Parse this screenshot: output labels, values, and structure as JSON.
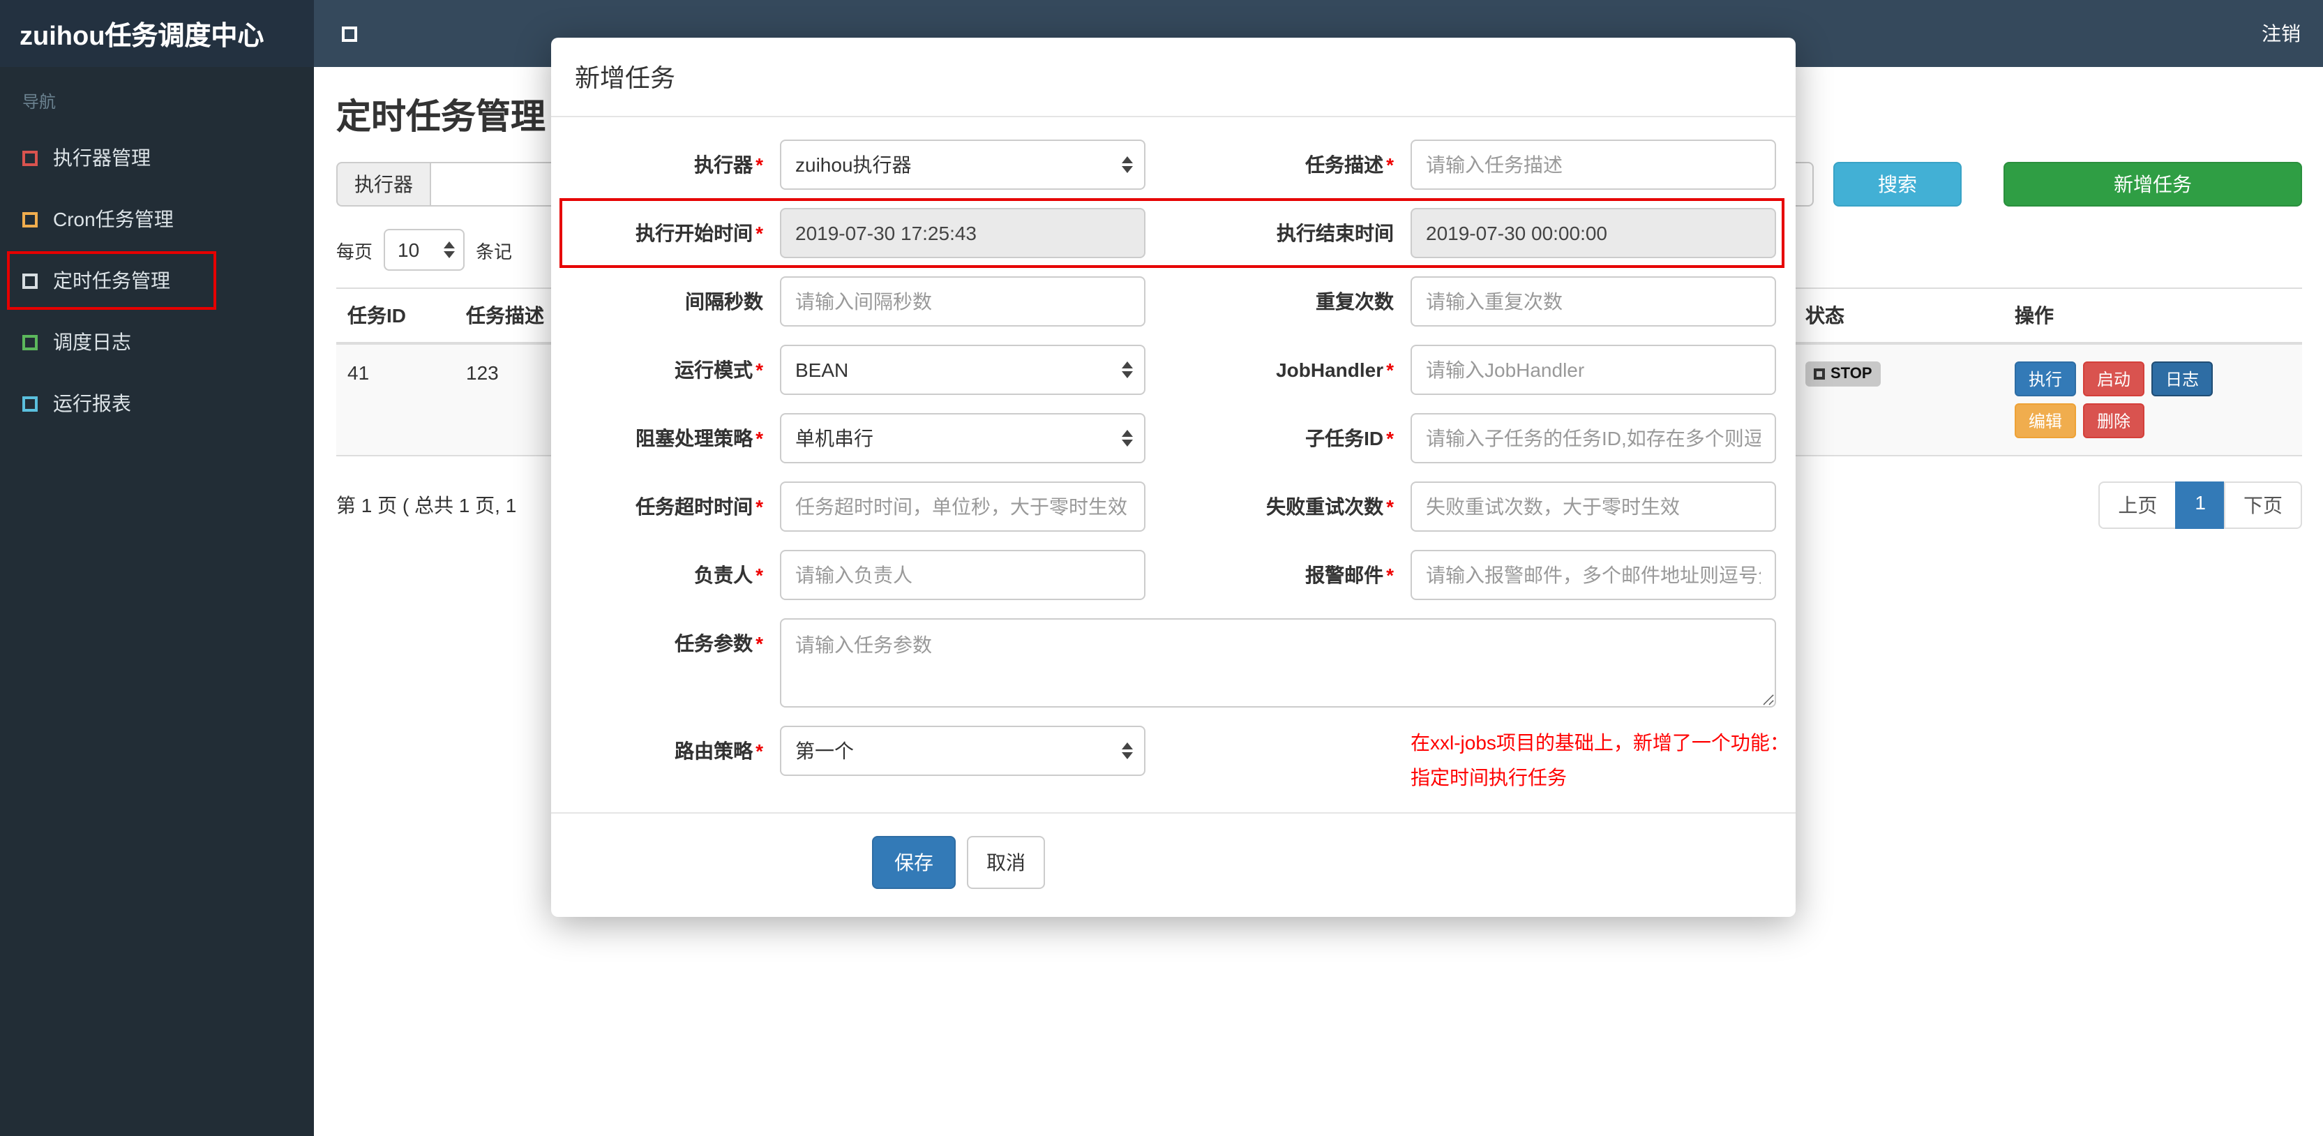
{
  "header": {
    "brand": "zuihou任务调度中心",
    "logout": "注销"
  },
  "sidebar": {
    "section_label": "导航",
    "items": [
      {
        "label": "执行器管理",
        "icon": "red-square-icon"
      },
      {
        "label": "Cron任务管理",
        "icon": "orange-square-icon"
      },
      {
        "label": "定时任务管理",
        "icon": "gray-square-icon",
        "annotated": true
      },
      {
        "label": "调度日志",
        "icon": "green-square-icon"
      },
      {
        "label": "运行报表",
        "icon": "cyan-square-icon"
      }
    ]
  },
  "main": {
    "page_title": "定时任务管理",
    "filter": {
      "executor_addon": "执行器",
      "search_button": "搜索",
      "add_button": "新增任务"
    },
    "per_page": {
      "prefix": "每页",
      "value": "10",
      "suffix": "条记"
    },
    "table": {
      "headers": {
        "id": "任务ID",
        "desc": "任务描述",
        "status": "状态",
        "actions": "操作"
      },
      "row": {
        "id": "41",
        "desc": "123",
        "status": "STOP",
        "actions": {
          "run": "执行",
          "start": "启动",
          "log": "日志",
          "edit": "编辑",
          "delete": "删除"
        }
      }
    },
    "pagination": {
      "summary": "第 1 页 ( 总共 1 页, 1",
      "prev": "上页",
      "page": "1",
      "next": "下页"
    }
  },
  "modal": {
    "title": "新增任务",
    "required_marker": "*",
    "fields": {
      "executor": {
        "label": "执行器",
        "value": "zuihou执行器"
      },
      "desc": {
        "label": "任务描述",
        "placeholder": "请输入任务描述"
      },
      "start_time": {
        "label": "执行开始时间",
        "value": "2019-07-30 17:25:43"
      },
      "end_time": {
        "label": "执行结束时间",
        "value": "2019-07-30 00:00:00"
      },
      "interval": {
        "label": "间隔秒数",
        "placeholder": "请输入间隔秒数"
      },
      "repeat": {
        "label": "重复次数",
        "placeholder": "请输入重复次数"
      },
      "run_mode": {
        "label": "运行模式",
        "value": "BEAN"
      },
      "job_handler": {
        "label": "JobHandler",
        "placeholder": "请输入JobHandler"
      },
      "block_strategy": {
        "label": "阻塞处理策略",
        "value": "单机串行"
      },
      "child_job": {
        "label": "子任务ID",
        "placeholder": "请输入子任务的任务ID,如存在多个则逗号分隔"
      },
      "timeout": {
        "label": "任务超时时间",
        "placeholder": "任务超时时间，单位秒，大于零时生效"
      },
      "retry": {
        "label": "失败重试次数",
        "placeholder": "失败重试次数，大于零时生效"
      },
      "owner": {
        "label": "负责人",
        "placeholder": "请输入负责人"
      },
      "alarm_email": {
        "label": "报警邮件",
        "placeholder": "请输入报警邮件，多个邮件地址则逗号分隔"
      },
      "params": {
        "label": "任务参数",
        "placeholder": "请输入任务参数"
      },
      "route_strategy": {
        "label": "路由策略",
        "value": "第一个"
      }
    },
    "note_line1": "在xxl-jobs项目的基础上，新增了一个功能：",
    "note_line2": "指定时间执行任务",
    "save_button": "保存",
    "cancel_button": "取消"
  },
  "colors": {
    "navbar": "#35495c",
    "brand_bg": "#233140",
    "sidebar_bg": "#222d36",
    "primary_blue": "#337ab7",
    "search_teal": "#42b0d5",
    "add_green": "#2f9e44",
    "danger_red": "#d9534f",
    "warning_orange": "#f0ad4e",
    "annotation_red": "#e60000",
    "note_red": "#ff0000"
  }
}
